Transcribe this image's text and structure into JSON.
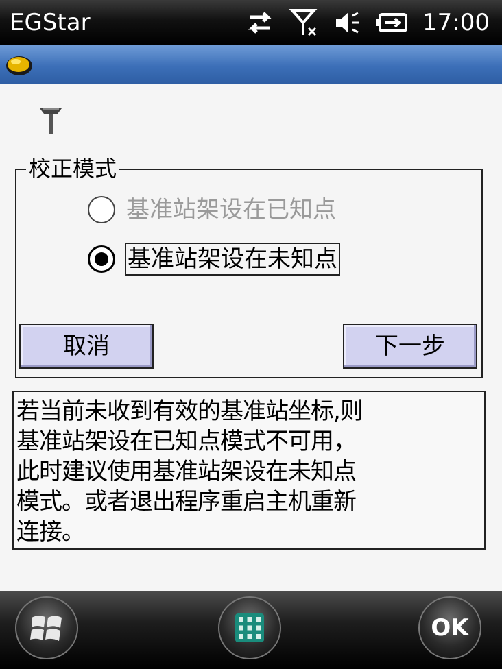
{
  "statusbar": {
    "app_title": "EGStar",
    "time": "17:00",
    "icons": [
      "sync-arrows-icon",
      "signal-off-icon",
      "volume-icon",
      "battery-charging-icon"
    ]
  },
  "titlebar": {
    "logo_icon": "app-logo-icon"
  },
  "content": {
    "gps_icon": "gps-antenna-icon",
    "group_title": "校正模式",
    "options": [
      {
        "label": "基准站架设在已知点",
        "checked": false,
        "enabled": false
      },
      {
        "label": "基准站架设在未知点",
        "checked": true,
        "enabled": true
      }
    ],
    "cancel_label": "取消",
    "next_label": "下一步",
    "message": "若当前未收到有效的基准站坐标,则\n基准站架设在已知点模式不可用，\n此时建议使用基准站架设在未知点\n模式。或者退出程序重启主机重新\n连接。"
  },
  "taskbar": {
    "start_icon": "windows-logo-icon",
    "apps_icon": "grid-apps-icon",
    "ok_label": "OK"
  },
  "colors": {
    "titlebar_blue": "#3c6fb8",
    "button_fill": "#d2d2f0",
    "disabled_text": "#9a9a9a"
  }
}
